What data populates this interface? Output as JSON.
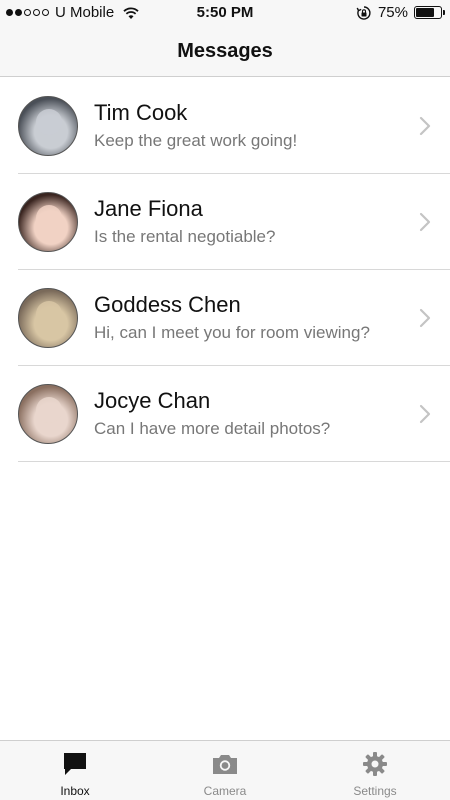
{
  "status_bar": {
    "carrier": "U Mobile",
    "time": "5:50 PM",
    "battery": "75%",
    "battery_level": 0.75,
    "signal_bars_filled": 2,
    "signal_bars_total": 5
  },
  "nav": {
    "title": "Messages"
  },
  "conversations": [
    {
      "name": "Tim Cook",
      "preview": "Keep the great work going!",
      "avatar_colors": [
        "#4a4f57",
        "#c9cdd3"
      ]
    },
    {
      "name": "Jane Fiona",
      "preview": "Is the rental negotiable?",
      "avatar_colors": [
        "#3a2520",
        "#f1d2c4"
      ]
    },
    {
      "name": "Goddess Chen",
      "preview": "Hi, can I meet you for room viewing?",
      "avatar_colors": [
        "#7a6a5a",
        "#d8c6a4"
      ]
    },
    {
      "name": "Jocye Chan",
      "preview": "Can I have more detail photos?",
      "avatar_colors": [
        "#8a6f60",
        "#e9d6cd"
      ]
    }
  ],
  "tabs": [
    {
      "label": "Inbox",
      "icon": "speech-bubble-icon",
      "active": true
    },
    {
      "label": "Camera",
      "icon": "camera-icon",
      "active": false
    },
    {
      "label": "Settings",
      "icon": "gear-icon",
      "active": false
    }
  ],
  "colors": {
    "bar_background": "#f7f7f7",
    "separator": "#d8d8d8",
    "inactive_tab": "#8a8a8a",
    "chevron": "#c4c4c4"
  }
}
